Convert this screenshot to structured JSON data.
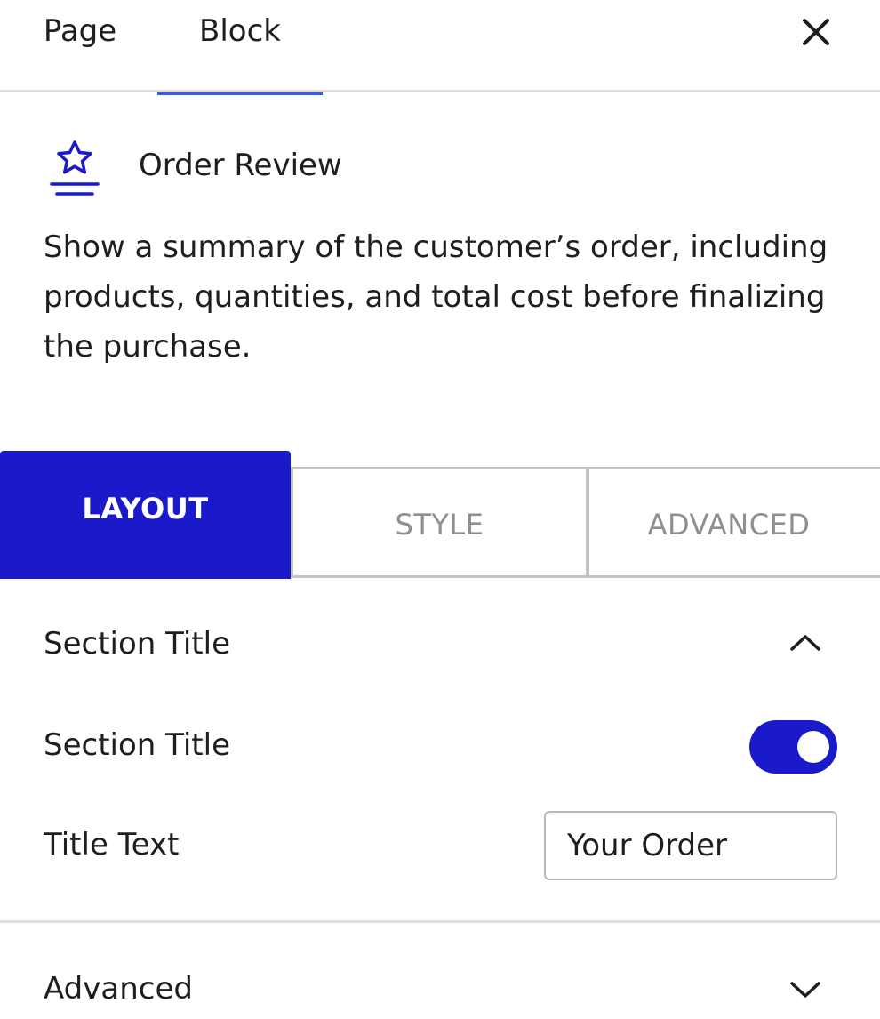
{
  "top_tabs": {
    "page_label": "Page",
    "block_label": "Block",
    "active": "Block"
  },
  "close_icon": "close-icon",
  "block": {
    "icon": "star-review-icon",
    "title": "Order Review",
    "description": "Show a summary of the customer’s order, including products, quantities, and total cost before finalizing the purchase."
  },
  "inspector_tabs": {
    "layout": "LAYOUT",
    "style": "STYLE",
    "advanced": "ADVANCED",
    "active": "LAYOUT"
  },
  "section_title_panel": {
    "heading": "Section Title",
    "expanded": true,
    "toggle_label": "Section Title",
    "toggle_on": true,
    "title_text_label": "Title Text",
    "title_text_value": "Your Order"
  },
  "advanced_panel": {
    "heading": "Advanced",
    "expanded": false
  },
  "colors": {
    "accent": "#1a1acb",
    "tab_underline": "#3858e9",
    "text": "#1e1e1e",
    "muted": "#8c8f94"
  }
}
